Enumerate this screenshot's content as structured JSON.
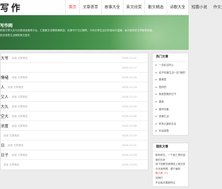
{
  "header": {
    "logo": "写作",
    "nav": [
      {
        "label": "首页",
        "active": true
      },
      {
        "label": "文章荟萃",
        "active": false
      },
      {
        "label": "故事大全",
        "active": false
      },
      {
        "label": "英文欣赏",
        "active": false
      },
      {
        "label": "散文精选",
        "active": false
      },
      {
        "label": "诗歌大全",
        "active": false
      },
      {
        "label": "短篇小说",
        "active": false
      },
      {
        "label": "作文大",
        "active": false
      }
    ]
  },
  "banner": {
    "title": "写作网",
    "desc": "精美文章大全与优质阅读推荐平台，汇集散文诗歌故事精选，优美句子日记随笔，与你分享生活中的感动与温暖，每天都有好文章推荐阅读，",
    "desc2": "励志感悟生活随笔美文赏析"
  },
  "articles": [
    {
      "title": "大爷",
      "tag": "阅读 文章精选",
      "date": "2020-11-02"
    },
    {
      "title": "",
      "tag": "",
      "date": "2020-12-17"
    },
    {
      "title": "情绪",
      "tag": "阅读 文章精选",
      "date": "2020-12-20"
    },
    {
      "title": "人",
      "tag": "阅读 文章精选",
      "date": "2020-12-14"
    },
    {
      "title": "又人",
      "tag": "阅读 文章精选",
      "date": "2020-12-12"
    },
    {
      "title": "大久",
      "tag": "阅读 文章精选",
      "date": "2020-12-30"
    },
    {
      "title": "空大",
      "tag": "阅读 文章精选",
      "date": "2020-12-06"
    },
    {
      "title": "浓度",
      "tag": "阅读 文章精选",
      "date": "2020-12-08"
    },
    {
      "title": "",
      "tag": "阅读 文章精选",
      "date": "2020-12-10"
    },
    {
      "title": "日",
      "tag": "阅读 文章精选",
      "date": "2020-12-11"
    },
    {
      "title": "日子",
      "tag": "阅读 文章精选",
      "date": "2020-12-03"
    },
    {
      "title": "",
      "tag": "阅读 文章精选",
      "date": "2020-12-04"
    }
  ],
  "sidebar_hot": {
    "heading": "热门文章",
    "items": [
      "一念走过的心",
      "给不知道生活一定\"愉悦\"",
      "素简里",
      "很好的",
      "宿舍里爬的日子",
      "重新",
      "爱好设备",
      "感谢生活",
      "听风从窗前去往",
      "年会感悟"
    ]
  },
  "sidebar_latest": {
    "heading": "随机文章",
    "items": [
      {
        "text": "那年那日，一个和三哥中回忆",
        "red": false
      },
      {
        "text": "我们无处",
        "red": false
      },
      {
        "text": "线下到那些错得线上家并多",
        "red": false
      },
      {
        "text": "今天我的眼，摄于面前",
        "red": false
      },
      {
        "text": "陪人林（2）",
        "red": true
      },
      {
        "text": "诗我们",
        "red": false
      },
      {
        "text": "不论每次善那的往",
        "red": false
      }
    ]
  }
}
